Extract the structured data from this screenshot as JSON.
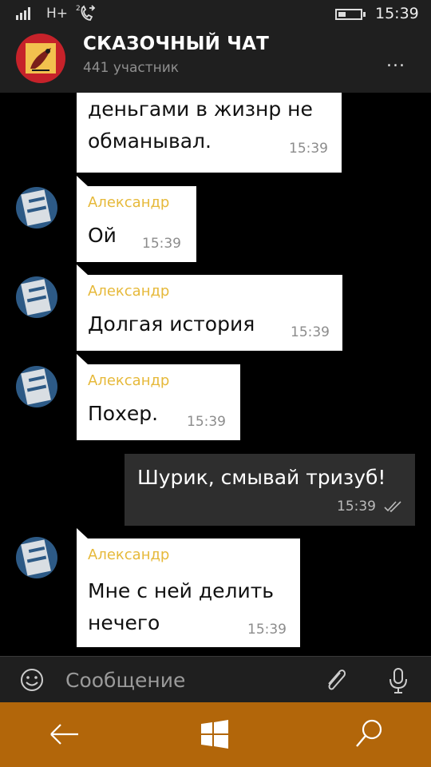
{
  "status_bar": {
    "network": "H+",
    "time": "15:39",
    "battery_level": 0.25
  },
  "header": {
    "title": "СКАЗОЧНЫЙ ЧАТ",
    "subtitle": "441 участник",
    "more_label": "..."
  },
  "messages": [
    {
      "direction": "in",
      "lines": [
        "деньгами в жизнр не",
        "обманывал."
      ],
      "time": "15:39"
    },
    {
      "direction": "in",
      "sender": "Александр",
      "lines": [
        "Ой"
      ],
      "time": "15:39"
    },
    {
      "direction": "in",
      "sender": "Александр",
      "lines": [
        "Долгая история"
      ],
      "time": "15:39"
    },
    {
      "direction": "in",
      "sender": "Александр",
      "lines": [
        "Похер."
      ],
      "time": "15:39"
    },
    {
      "direction": "out",
      "lines": [
        "Шурик, смывай тризуб!"
      ],
      "time": "15:39"
    },
    {
      "direction": "in",
      "sender": "Александр",
      "lines": [
        "Мне с ней делить",
        "нечего"
      ],
      "time": "15:39"
    }
  ],
  "input": {
    "placeholder": "Сообщение"
  },
  "icons": {
    "emoji": "emoji-icon",
    "attach": "paperclip-icon",
    "mic": "microphone-icon",
    "back": "back-arrow-icon",
    "start": "windows-logo-icon",
    "search": "search-icon"
  },
  "colors": {
    "bar": "#1f1f1f",
    "sender": "#e6b93a",
    "navbar": "#b2660a",
    "incoming_bubble": "#ffffff",
    "outgoing_bubble": "#2e2e2e"
  }
}
